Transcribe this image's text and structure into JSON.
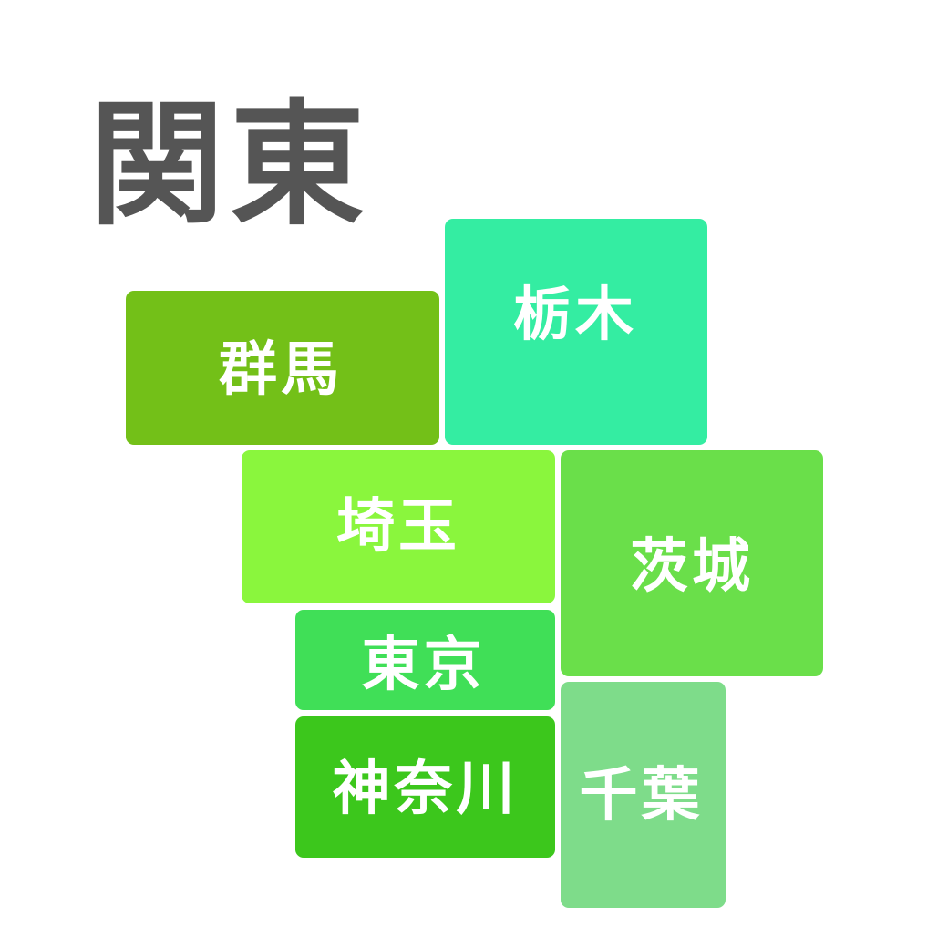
{
  "title": "関東",
  "prefectures": [
    {
      "id": "gunma",
      "label": "群馬",
      "color": "#73C018"
    },
    {
      "id": "tochigi",
      "label": "栃木",
      "color": "#34EDA2"
    },
    {
      "id": "saitama",
      "label": "埼玉",
      "color": "#8AF63D"
    },
    {
      "id": "ibaraki",
      "label": "茨城",
      "color": "#6ADF4A"
    },
    {
      "id": "tokyo",
      "label": "東京",
      "color": "#40DF57"
    },
    {
      "id": "kanagawa",
      "label": "神奈川",
      "color": "#3CC71C"
    },
    {
      "id": "chiba",
      "label": "千葉",
      "color": "#7EDC8A"
    }
  ]
}
